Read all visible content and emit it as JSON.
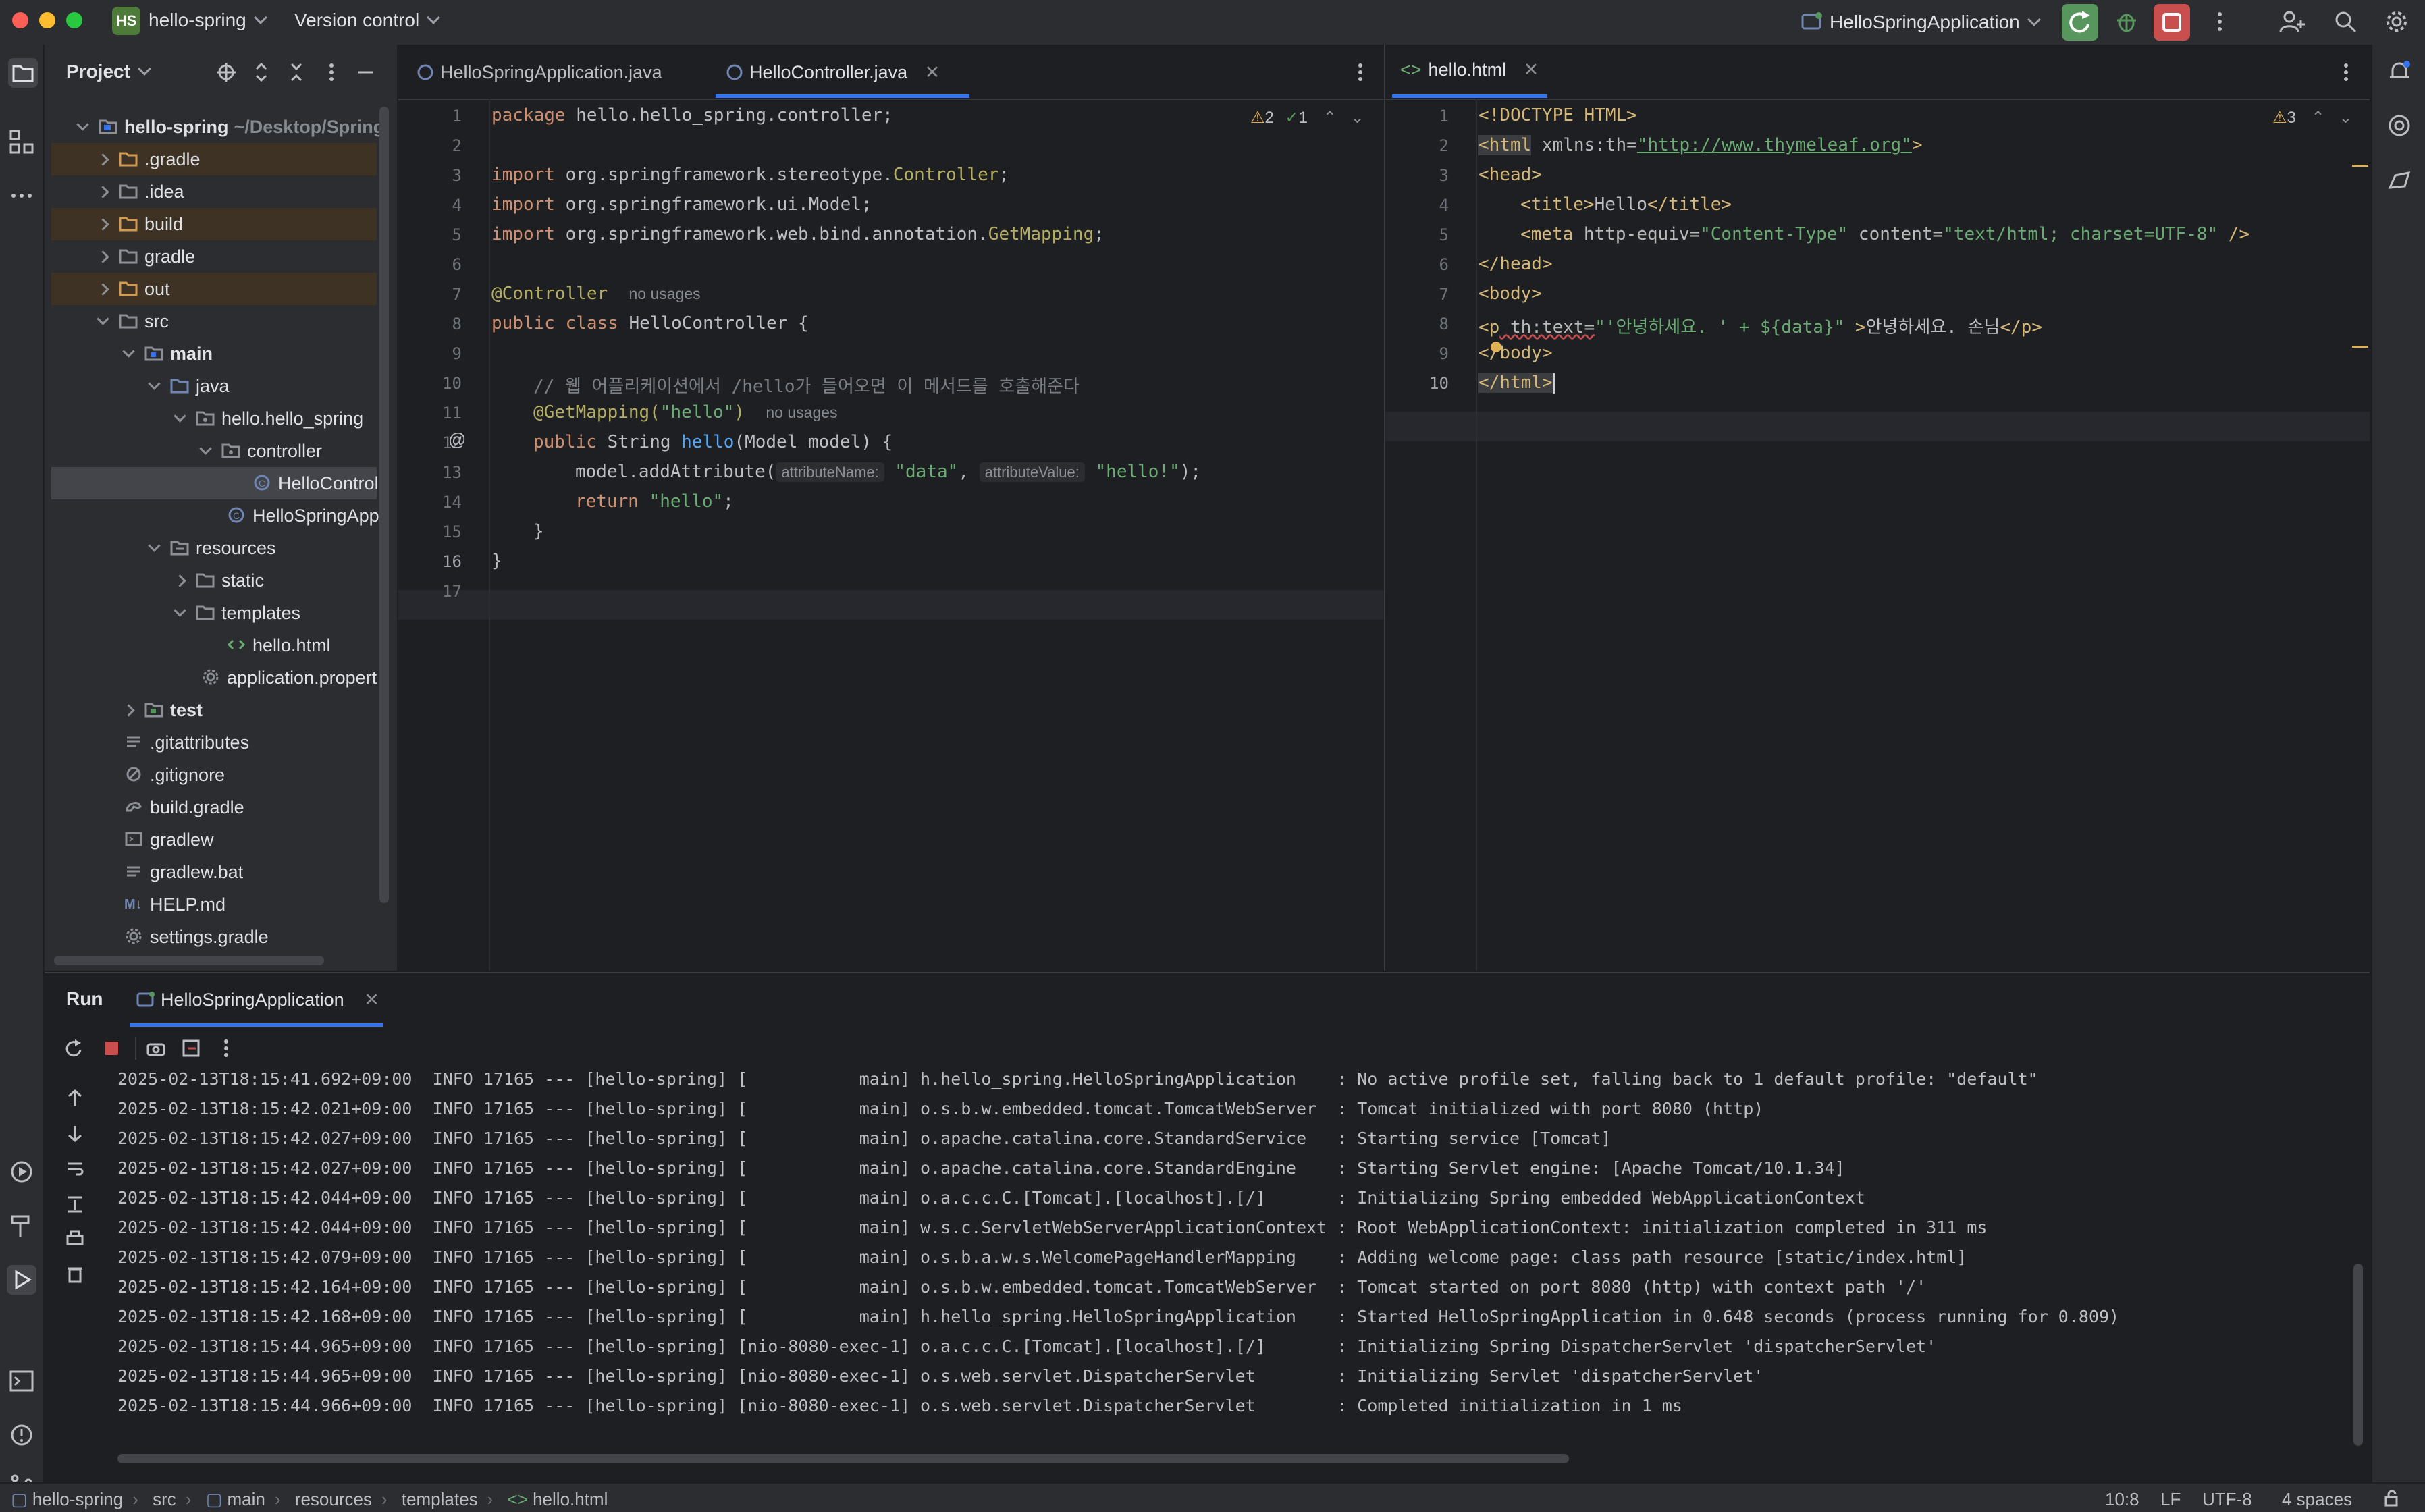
{
  "titlebar": {
    "project_badge": "HS",
    "project_name": "hello-spring",
    "vcs": "Version control",
    "run_config": "HelloSpringApplication"
  },
  "project_panel": {
    "title": "Project",
    "rows": [
      {
        "label": "hello-spring",
        "path": "~/Desktop/Spring",
        "bold": true
      },
      {
        "label": ".gradle"
      },
      {
        "label": ".idea"
      },
      {
        "label": "build"
      },
      {
        "label": "gradle"
      },
      {
        "label": "out"
      },
      {
        "label": "src"
      },
      {
        "label": "main",
        "bold": true
      },
      {
        "label": "java"
      },
      {
        "label": "hello.hello_spring"
      },
      {
        "label": "controller"
      },
      {
        "label": "HelloControll"
      },
      {
        "label": "HelloSpringAppl"
      },
      {
        "label": "resources"
      },
      {
        "label": "static"
      },
      {
        "label": "templates"
      },
      {
        "label": "hello.html"
      },
      {
        "label": "application.propert"
      },
      {
        "label": "test",
        "bold": true
      },
      {
        "label": ".gitattributes"
      },
      {
        "label": ".gitignore"
      },
      {
        "label": "build.gradle"
      },
      {
        "label": "gradlew"
      },
      {
        "label": "gradlew.bat"
      },
      {
        "label": "HELP.md"
      },
      {
        "label": "settings.gradle"
      }
    ],
    "md_badge": "M↓"
  },
  "editor_left": {
    "tabs": [
      "HelloSpringApplication.java",
      "HelloController.java"
    ],
    "inspections": {
      "warnings": "2",
      "ok": "1"
    },
    "line_numbers": [
      "1",
      "2",
      "3",
      "4",
      "5",
      "6",
      "7",
      "8",
      "9",
      "10",
      "11",
      "12",
      "13",
      "14",
      "15",
      "16",
      "17"
    ],
    "code": {
      "l1a": "package ",
      "l1b": "hello.hello_spring.controller;",
      "l3a": "import ",
      "l3b": "org.springframework.stereotype.",
      "l3c": "Controller",
      "l3d": ";",
      "l4a": "import ",
      "l4b": "org.springframework.ui.Model;",
      "l5a": "import ",
      "l5b": "org.springframework.web.bind.annotation.",
      "l5c": "GetMapping",
      "l5d": ";",
      "l7a": "@Controller",
      "l7b": "no usages",
      "l8a": "public class ",
      "l8b": "HelloController",
      "l8c": " {",
      "l10": "// 웹 어플리케이션에서 /hello가 들어오면 이 메서드를 호출해준다",
      "l11a": "@GetMapping(",
      "l11b": "\"hello\"",
      "l11c": ")",
      "l11d": "no usages",
      "l12a": "public ",
      "l12b": "String ",
      "l12c": "hello",
      "l12d": "(Model model) {",
      "l13a": "model.addAttribute(",
      "l13h1": "attributeName:",
      "l13b": "\"data\"",
      "l13c": ", ",
      "l13h2": "attributeValue:",
      "l13d": "\"hello!\"",
      "l13e": ");",
      "l14a": "return ",
      "l14b": "\"hello\"",
      "l14c": ";",
      "l15": "}",
      "l16": "}"
    }
  },
  "editor_right": {
    "tabs": [
      "hello.html"
    ],
    "inspections": {
      "warnings": "3"
    },
    "line_numbers": [
      "1",
      "2",
      "3",
      "4",
      "5",
      "6",
      "7",
      "8",
      "9",
      "10"
    ],
    "code": {
      "l1": "<!DOCTYPE HTML>",
      "l2a": "<html",
      "l2b": " xmlns:th=",
      "l2c": "\"http://www.thymeleaf.org\"",
      "l2d": ">",
      "l3": "<head>",
      "l4a": "<title>",
      "l4b": "Hello",
      "l4c": "</title>",
      "l5a": "<meta",
      "l5b": " http-equiv=",
      "l5c": "\"Content-Type\"",
      "l5d": " content=",
      "l5e": "\"text/html; charset=UTF-8\"",
      "l5f": " />",
      "l6": "</head>",
      "l7": "<body>",
      "l8a": "<p",
      "l8b": " th:text=",
      "l8c": "\"'안녕하세요. ' + ${data}\"",
      "l8d": " >",
      "l8e": "안녕하세요. 손님",
      "l8f": "</p>",
      "l9": "</body>",
      "l10": "</html>"
    }
  },
  "run_panel": {
    "title": "Run",
    "tab": "HelloSpringApplication",
    "log": [
      "2025-02-13T18:15:41.692+09:00  INFO 17165 --- [hello-spring] [           main] h.hello_spring.HelloSpringApplication    : No active profile set, falling back to 1 default profile: \"default\"",
      "2025-02-13T18:15:42.021+09:00  INFO 17165 --- [hello-spring] [           main] o.s.b.w.embedded.tomcat.TomcatWebServer  : Tomcat initialized with port 8080 (http)",
      "2025-02-13T18:15:42.027+09:00  INFO 17165 --- [hello-spring] [           main] o.apache.catalina.core.StandardService   : Starting service [Tomcat]",
      "2025-02-13T18:15:42.027+09:00  INFO 17165 --- [hello-spring] [           main] o.apache.catalina.core.StandardEngine    : Starting Servlet engine: [Apache Tomcat/10.1.34]",
      "2025-02-13T18:15:42.044+09:00  INFO 17165 --- [hello-spring] [           main] o.a.c.c.C.[Tomcat].[localhost].[/]       : Initializing Spring embedded WebApplicationContext",
      "2025-02-13T18:15:42.044+09:00  INFO 17165 --- [hello-spring] [           main] w.s.c.ServletWebServerApplicationContext : Root WebApplicationContext: initialization completed in 311 ms",
      "2025-02-13T18:15:42.079+09:00  INFO 17165 --- [hello-spring] [           main] o.s.b.a.w.s.WelcomePageHandlerMapping    : Adding welcome page: class path resource [static/index.html]",
      "2025-02-13T18:15:42.164+09:00  INFO 17165 --- [hello-spring] [           main] o.s.b.w.embedded.tomcat.TomcatWebServer  : Tomcat started on port 8080 (http) with context path '/'",
      "2025-02-13T18:15:42.168+09:00  INFO 17165 --- [hello-spring] [           main] h.hello_spring.HelloSpringApplication    : Started HelloSpringApplication in 0.648 seconds (process running for 0.809)",
      "2025-02-13T18:15:44.965+09:00  INFO 17165 --- [hello-spring] [nio-8080-exec-1] o.a.c.c.C.[Tomcat].[localhost].[/]       : Initializing Spring DispatcherServlet 'dispatcherServlet'",
      "2025-02-13T18:15:44.965+09:00  INFO 17165 --- [hello-spring] [nio-8080-exec-1] o.s.web.servlet.DispatcherServlet        : Initializing Servlet 'dispatcherServlet'",
      "2025-02-13T18:15:44.966+09:00  INFO 17165 --- [hello-spring] [nio-8080-exec-1] o.s.web.servlet.DispatcherServlet        : Completed initialization in 1 ms"
    ]
  },
  "statusbar": {
    "breadcrumb": [
      "hello-spring",
      "src",
      "main",
      "resources",
      "templates",
      "hello.html"
    ],
    "position": "10:8",
    "line_sep": "LF",
    "encoding": "UTF-8",
    "indent": "4 spaces"
  },
  "colors": {
    "accent": "#3574f0",
    "run_green": "#57965c",
    "stop_red": "#c94f4f",
    "folder_excluded_bg": "#3d3223"
  }
}
